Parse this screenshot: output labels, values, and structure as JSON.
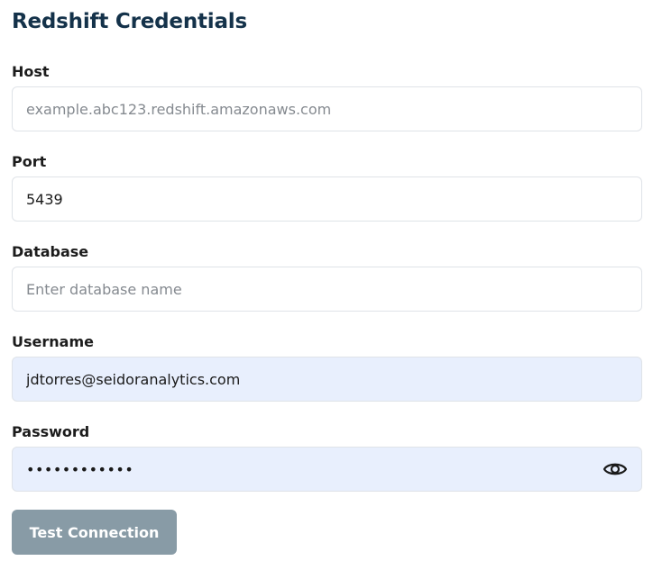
{
  "title": "Redshift Credentials",
  "fields": {
    "host": {
      "label": "Host",
      "value": "",
      "placeholder": "example.abc123.redshift.amazonaws.com"
    },
    "port": {
      "label": "Port",
      "value": "5439",
      "placeholder": ""
    },
    "database": {
      "label": "Database",
      "value": "",
      "placeholder": "Enter database name"
    },
    "username": {
      "label": "Username",
      "value": "jdtorres@seidoranalytics.com",
      "placeholder": ""
    },
    "password": {
      "label": "Password",
      "value": "••••••••••••",
      "placeholder": ""
    }
  },
  "icons": {
    "password_toggle": "eye-icon"
  },
  "buttons": {
    "test_connection": "Test Connection"
  },
  "colors": {
    "title": "#14324a",
    "autofill_bg": "#e8effd",
    "button_disabled": "#889ba6"
  }
}
